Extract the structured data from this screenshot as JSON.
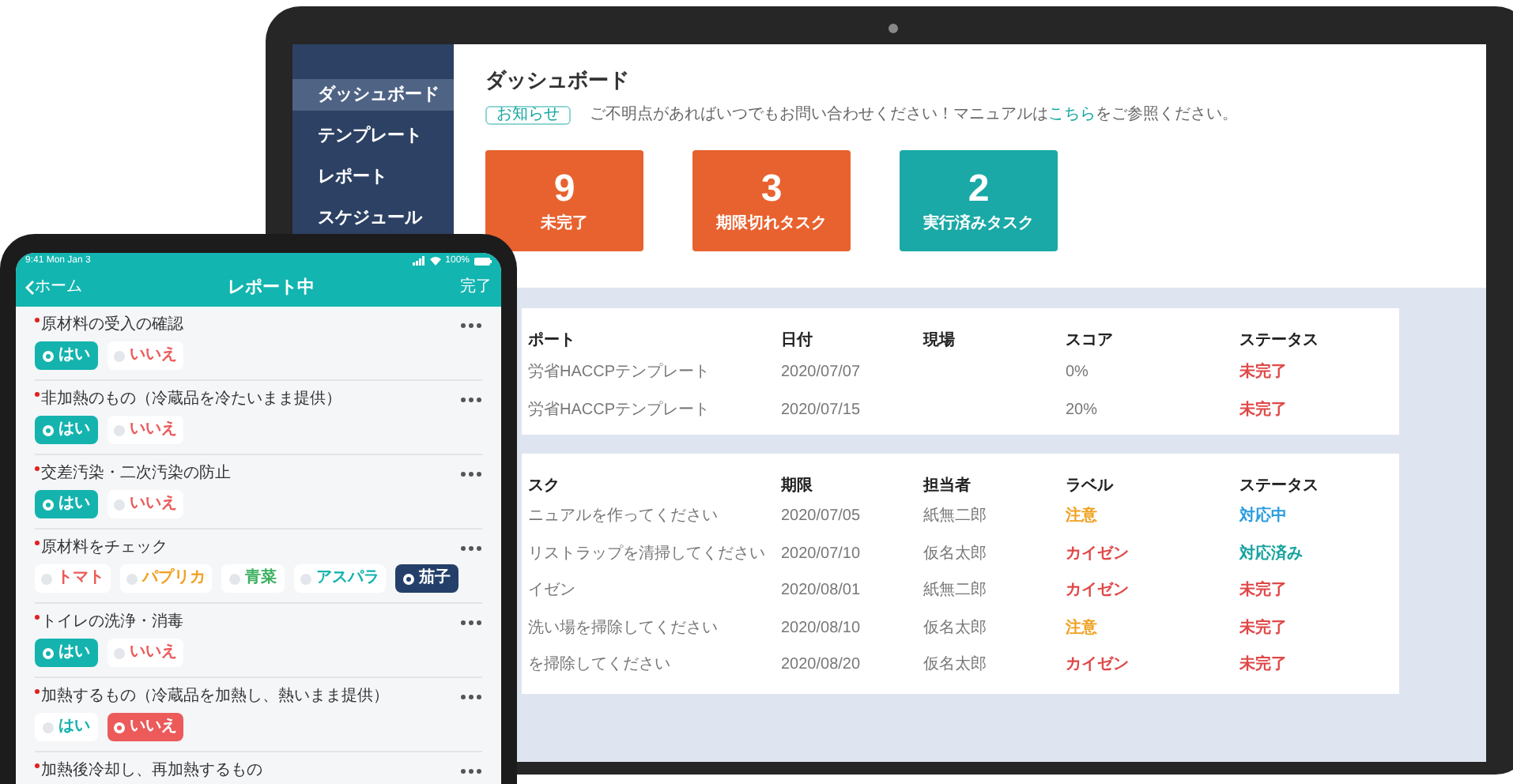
{
  "laptop": {
    "sidebar": {
      "items": [
        {
          "label": "ダッシュボード",
          "selected": true
        },
        {
          "label": "テンプレート",
          "selected": false
        },
        {
          "label": "レポート",
          "selected": false
        },
        {
          "label": "スケジュール",
          "selected": false
        }
      ]
    },
    "page_title": "ダッシュボード",
    "notice": {
      "badge": "お知らせ",
      "text_before": "ご不明点があればいつでもお問い合わせください！マニュアルは",
      "link": "こちら",
      "text_after": "をご参照ください。"
    },
    "stats": [
      {
        "value": "9",
        "label": "未完了",
        "color": "#e8622f"
      },
      {
        "value": "3",
        "label": "期限切れタスク",
        "color": "#e8622f"
      },
      {
        "value": "2",
        "label": "実行済みタスク",
        "color": "#1aa9a6"
      }
    ],
    "reports": {
      "columns": [
        "ポート",
        "日付",
        "現場",
        "スコア",
        "ステータス"
      ],
      "rows": [
        {
          "name": "労省HACCPテンプレート",
          "date": "2020/07/07",
          "score": "0%",
          "status": {
            "text": "未完了",
            "color": "#e04848"
          }
        },
        {
          "name": "労省HACCPテンプレート",
          "date": "2020/07/15",
          "score": "20%",
          "status": {
            "text": "未完了",
            "color": "#e04848"
          }
        }
      ]
    },
    "tasks": {
      "columns": [
        "スク",
        "期限",
        "担当者",
        "ラベル",
        "ステータス"
      ],
      "rows": [
        {
          "name": "ニュアルを作ってください",
          "due": "2020/07/05",
          "assignee": "紙無二郎",
          "label": {
            "text": "注意",
            "color": "#f0a020"
          },
          "status": {
            "text": "対応中",
            "color": "#2a9de0"
          }
        },
        {
          "name": "リストラップを清掃してください",
          "due": "2020/07/10",
          "assignee": "仮名太郎",
          "label": {
            "text": "カイゼン",
            "color": "#e04848"
          },
          "status": {
            "text": "対応済み",
            "color": "#15a39e"
          }
        },
        {
          "name": "イゼン",
          "due": "2020/08/01",
          "assignee": "紙無二郎",
          "label": {
            "text": "カイゼン",
            "color": "#e04848"
          },
          "status": {
            "text": "未完了",
            "color": "#e04848"
          }
        },
        {
          "name": "洗い場を掃除してください",
          "due": "2020/08/10",
          "assignee": "仮名太郎",
          "label": {
            "text": "注意",
            "color": "#f0a020"
          },
          "status": {
            "text": "未完了",
            "color": "#e04848"
          }
        },
        {
          "name": "を掃除してください",
          "due": "2020/08/20",
          "assignee": "仮名太郎",
          "label": {
            "text": "カイゼン",
            "color": "#e04848"
          },
          "status": {
            "text": "未完了",
            "color": "#e04848"
          }
        }
      ]
    }
  },
  "tablet": {
    "status_bar": {
      "time": "9:41 Mon Jan 3",
      "battery": "100%"
    },
    "nav": {
      "back": "ホーム",
      "title": "レポート中",
      "done": "完了"
    },
    "questions": [
      {
        "label": "原材料の受入の確認",
        "required": true,
        "options": [
          {
            "label": "はい",
            "selected": true,
            "color": "#14b3ae"
          },
          {
            "label": "いいえ",
            "selected": false,
            "color": "#ec5a5a"
          }
        ]
      },
      {
        "label": "非加熱のもの（冷蔵品を冷たいまま提供）",
        "required": true,
        "options": [
          {
            "label": "はい",
            "selected": true,
            "color": "#14b3ae"
          },
          {
            "label": "いいえ",
            "selected": false,
            "color": "#ec5a5a"
          }
        ]
      },
      {
        "label": "交差汚染・二次汚染の防止",
        "required": true,
        "options": [
          {
            "label": "はい",
            "selected": true,
            "color": "#14b3ae"
          },
          {
            "label": "いいえ",
            "selected": false,
            "color": "#ec5a5a"
          }
        ]
      },
      {
        "label": "原材料をチェック",
        "required": true,
        "options": [
          {
            "label": "トマト",
            "selected": false,
            "color": "#ec5a5a"
          },
          {
            "label": "パプリカ",
            "selected": false,
            "color": "#f0a020"
          },
          {
            "label": "青菜",
            "selected": false,
            "color": "#3cb060"
          },
          {
            "label": "アスパラ",
            "selected": false,
            "color": "#14b3ae"
          },
          {
            "label": "茄子",
            "selected": true,
            "color": "#24406a"
          }
        ]
      },
      {
        "label": "トイレの洗浄・消毒",
        "required": true,
        "options": [
          {
            "label": "はい",
            "selected": true,
            "color": "#14b3ae"
          },
          {
            "label": "いいえ",
            "selected": false,
            "color": "#ec5a5a"
          }
        ]
      },
      {
        "label": "加熱するもの（冷蔵品を加熱し、熱いまま提供）",
        "required": true,
        "options": [
          {
            "label": "はい",
            "selected": false,
            "color": "#14b3ae"
          },
          {
            "label": "いいえ",
            "selected": true,
            "color": "#ec5a5a"
          }
        ]
      },
      {
        "label": "加熱後冷却し、再加熱するもの",
        "required": true
      }
    ]
  }
}
